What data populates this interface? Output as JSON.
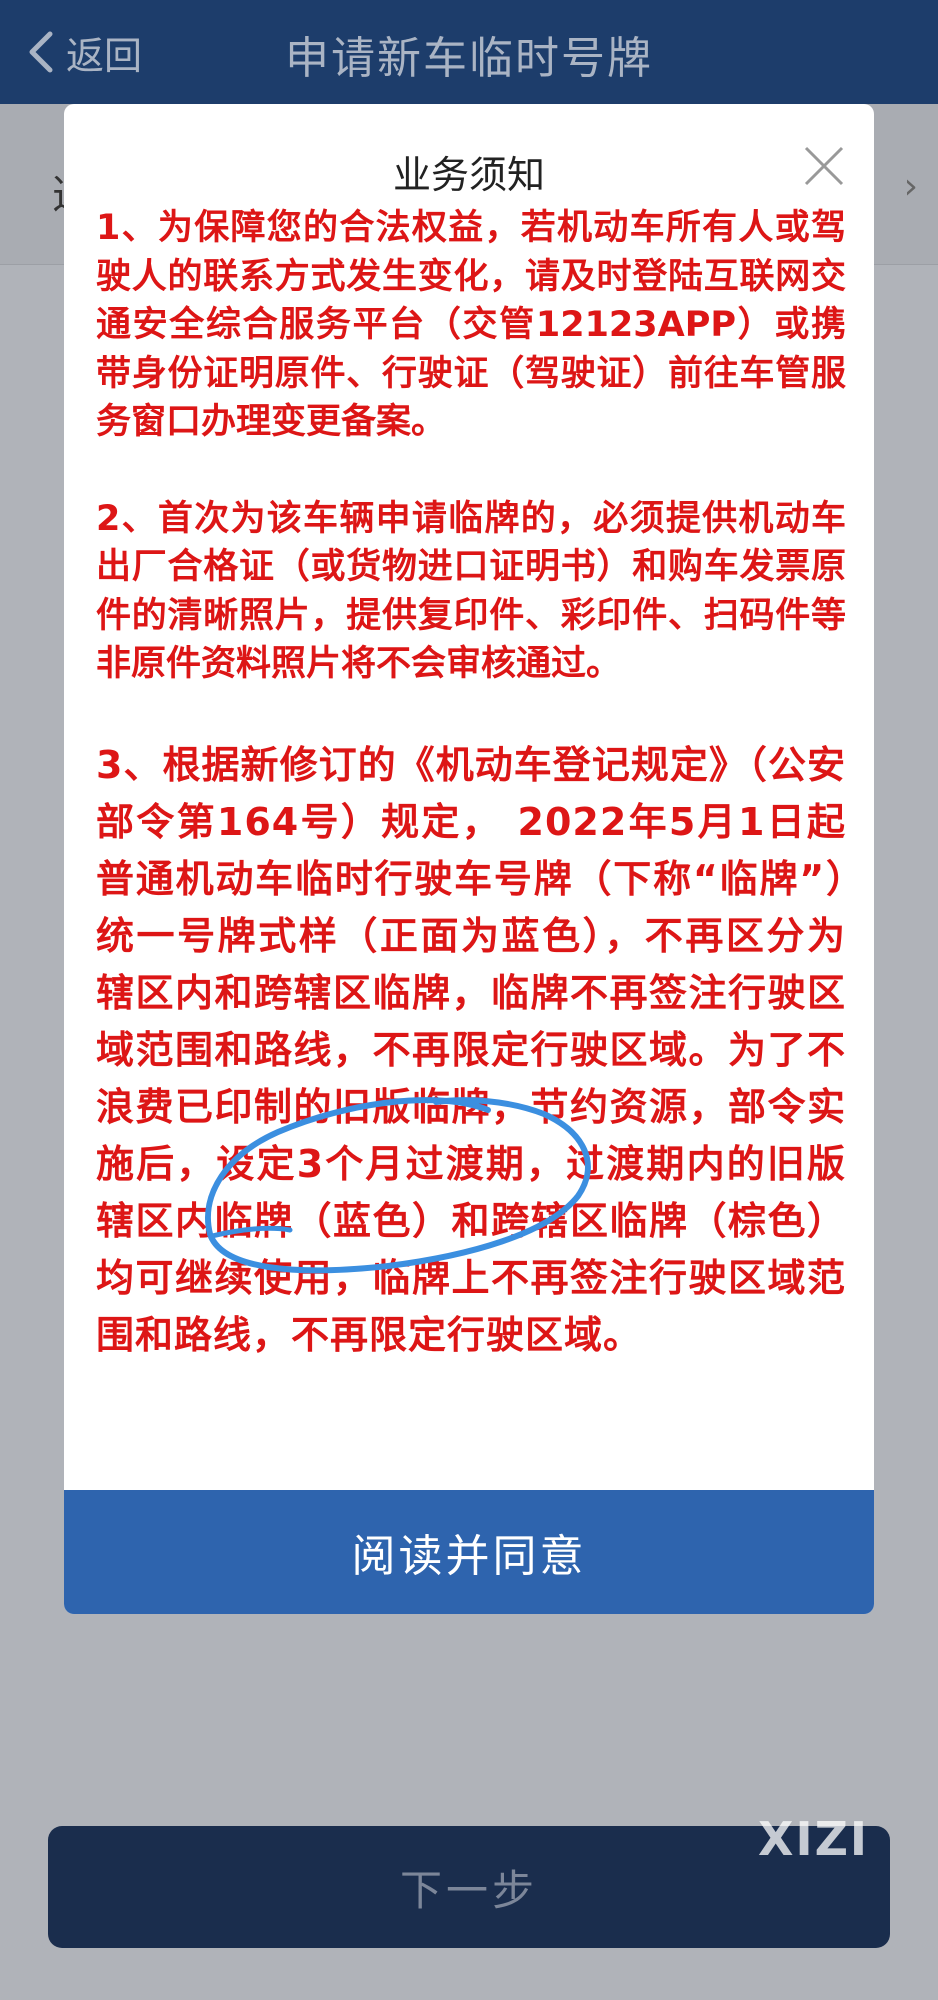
{
  "navbar": {
    "back_label": "返回",
    "title": "申请新车临时号牌"
  },
  "underlay": {
    "row_text": "选",
    "next_label": "下一步"
  },
  "watermark": "XIZI",
  "modal": {
    "title": "业务须知",
    "paragraphs": [
      "1、为保障您的合法权益，若机动车所有人或驾驶人的联系方式发生变化，请及时登陆互联网交通安全综合服务平台（交管12123APP）或携带身份证明原件、行驶证（驾驶证）前往车管服务窗口办理变更备案。",
      "2、首次为该车辆申请临牌的，必须提供机动车出厂合格证（或货物进口证明书）和购车发票原件的清晰照片，提供复印件、彩印件、扫码件等非原件资料照片将不会审核通过。",
      "3、根据新修订的《机动车登记规定》（公安部令第164号）规定， 2022年5月1日起普通机动车临时行驶车号牌（下称“临牌”）统一号牌式样（正面为蓝色），不再区分为辖区内和跨辖区临牌，临牌不再签注行驶区域范围和路线，不再限定行驶区域。为了不浪费已印制的旧版临牌，节约资源，部令实施后，设定3个月过渡期，过渡期内的旧版辖区内临牌（蓝色）和跨辖区临牌（棕色）均可继续使用，临牌上不再签注行驶区域范围和路线，不再限定行驶区域。"
    ],
    "agree_label": "阅读并同意"
  },
  "colors": {
    "navbar": "#1d3d6b",
    "notice_text": "#dd1616",
    "agree_button": "#2e64ae",
    "scribble": "#3b8fe0"
  }
}
